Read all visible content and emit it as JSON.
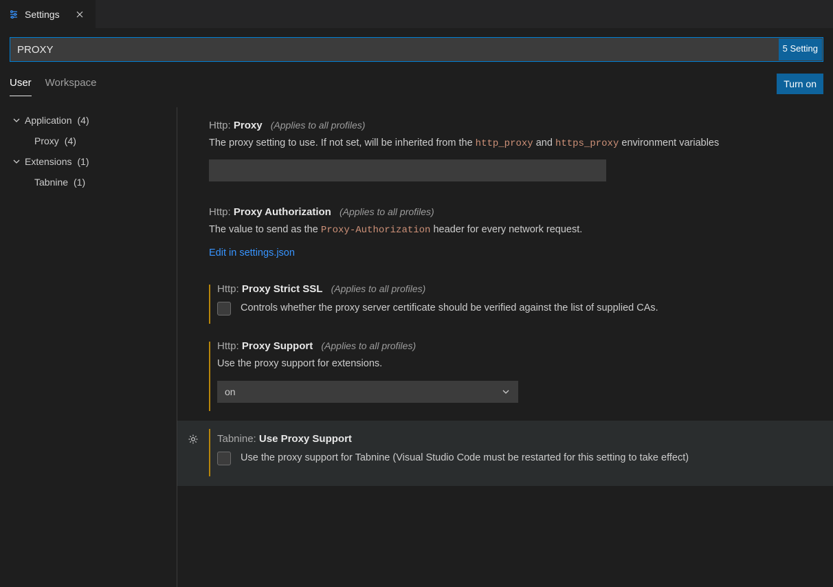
{
  "tab": {
    "label": "Settings"
  },
  "search": {
    "value": "PROXY",
    "result_count": "5 Setting"
  },
  "scopes": {
    "user": "User",
    "workspace": "Workspace"
  },
  "sync_button": "Turn on",
  "sidebar": {
    "application": {
      "label": "Application",
      "count": "(4)"
    },
    "proxy": {
      "label": "Proxy",
      "count": "(4)"
    },
    "extensions": {
      "label": "Extensions",
      "count": "(1)"
    },
    "tabnine": {
      "label": "Tabnine",
      "count": "(1)"
    }
  },
  "settings": {
    "scope_note": "(Applies to all profiles)",
    "http_proxy": {
      "prefix": "Http: ",
      "name": "Proxy",
      "desc_a": "The proxy setting to use. If not set, will be inherited from the ",
      "code_a": "http_proxy",
      "desc_b": " and ",
      "code_b": "https_proxy",
      "desc_c": " environment variables"
    },
    "proxy_auth": {
      "prefix": "Http: ",
      "name": "Proxy Authorization",
      "desc_a": "The value to send as the ",
      "code_a": "Proxy-Authorization",
      "desc_b": " header for every network request.",
      "link": "Edit in settings.json"
    },
    "strict_ssl": {
      "prefix": "Http: ",
      "name": "Proxy Strict SSL",
      "checkbox_label": "Controls whether the proxy server certificate should be verified against the list of supplied CAs."
    },
    "proxy_support": {
      "prefix": "Http: ",
      "name": "Proxy Support",
      "desc": "Use the proxy support for extensions.",
      "value": "on"
    },
    "tabnine": {
      "prefix": "Tabnine: ",
      "name": "Use Proxy Support",
      "checkbox_label": "Use the proxy support for Tabnine (Visual Studio Code must be restarted for this setting to take effect)"
    }
  }
}
